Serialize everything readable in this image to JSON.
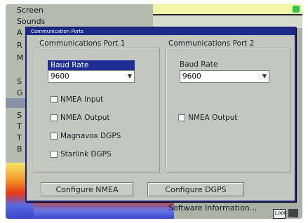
{
  "background": {
    "menu_items": [
      "Screen",
      "Sounds",
      "A",
      "R",
      "M",
      "S",
      "G",
      "S",
      "T",
      "T",
      "B"
    ],
    "software_info": "Software Information...",
    "status_chip": "1,000"
  },
  "dialog": {
    "title": "Communication Ports",
    "port1": {
      "title": "Communications Port 1",
      "baud_label": "Baud Rate",
      "baud_value": "9600",
      "checkboxes": [
        {
          "label": "NMEA Input",
          "checked": false
        },
        {
          "label": "NMEA Output",
          "checked": false
        },
        {
          "label": "Magnavox DGPS",
          "checked": false
        },
        {
          "label": "Starlink DGPS",
          "checked": false
        }
      ]
    },
    "port2": {
      "title": "Communications Port 2",
      "baud_label": "Baud Rate",
      "baud_value": "9600",
      "checkboxes": [
        {
          "label": "NMEA Output",
          "checked": false
        }
      ]
    },
    "buttons": {
      "configure_nmea": "Configure NMEA",
      "configure_dgps": "Configure DGPS"
    }
  }
}
